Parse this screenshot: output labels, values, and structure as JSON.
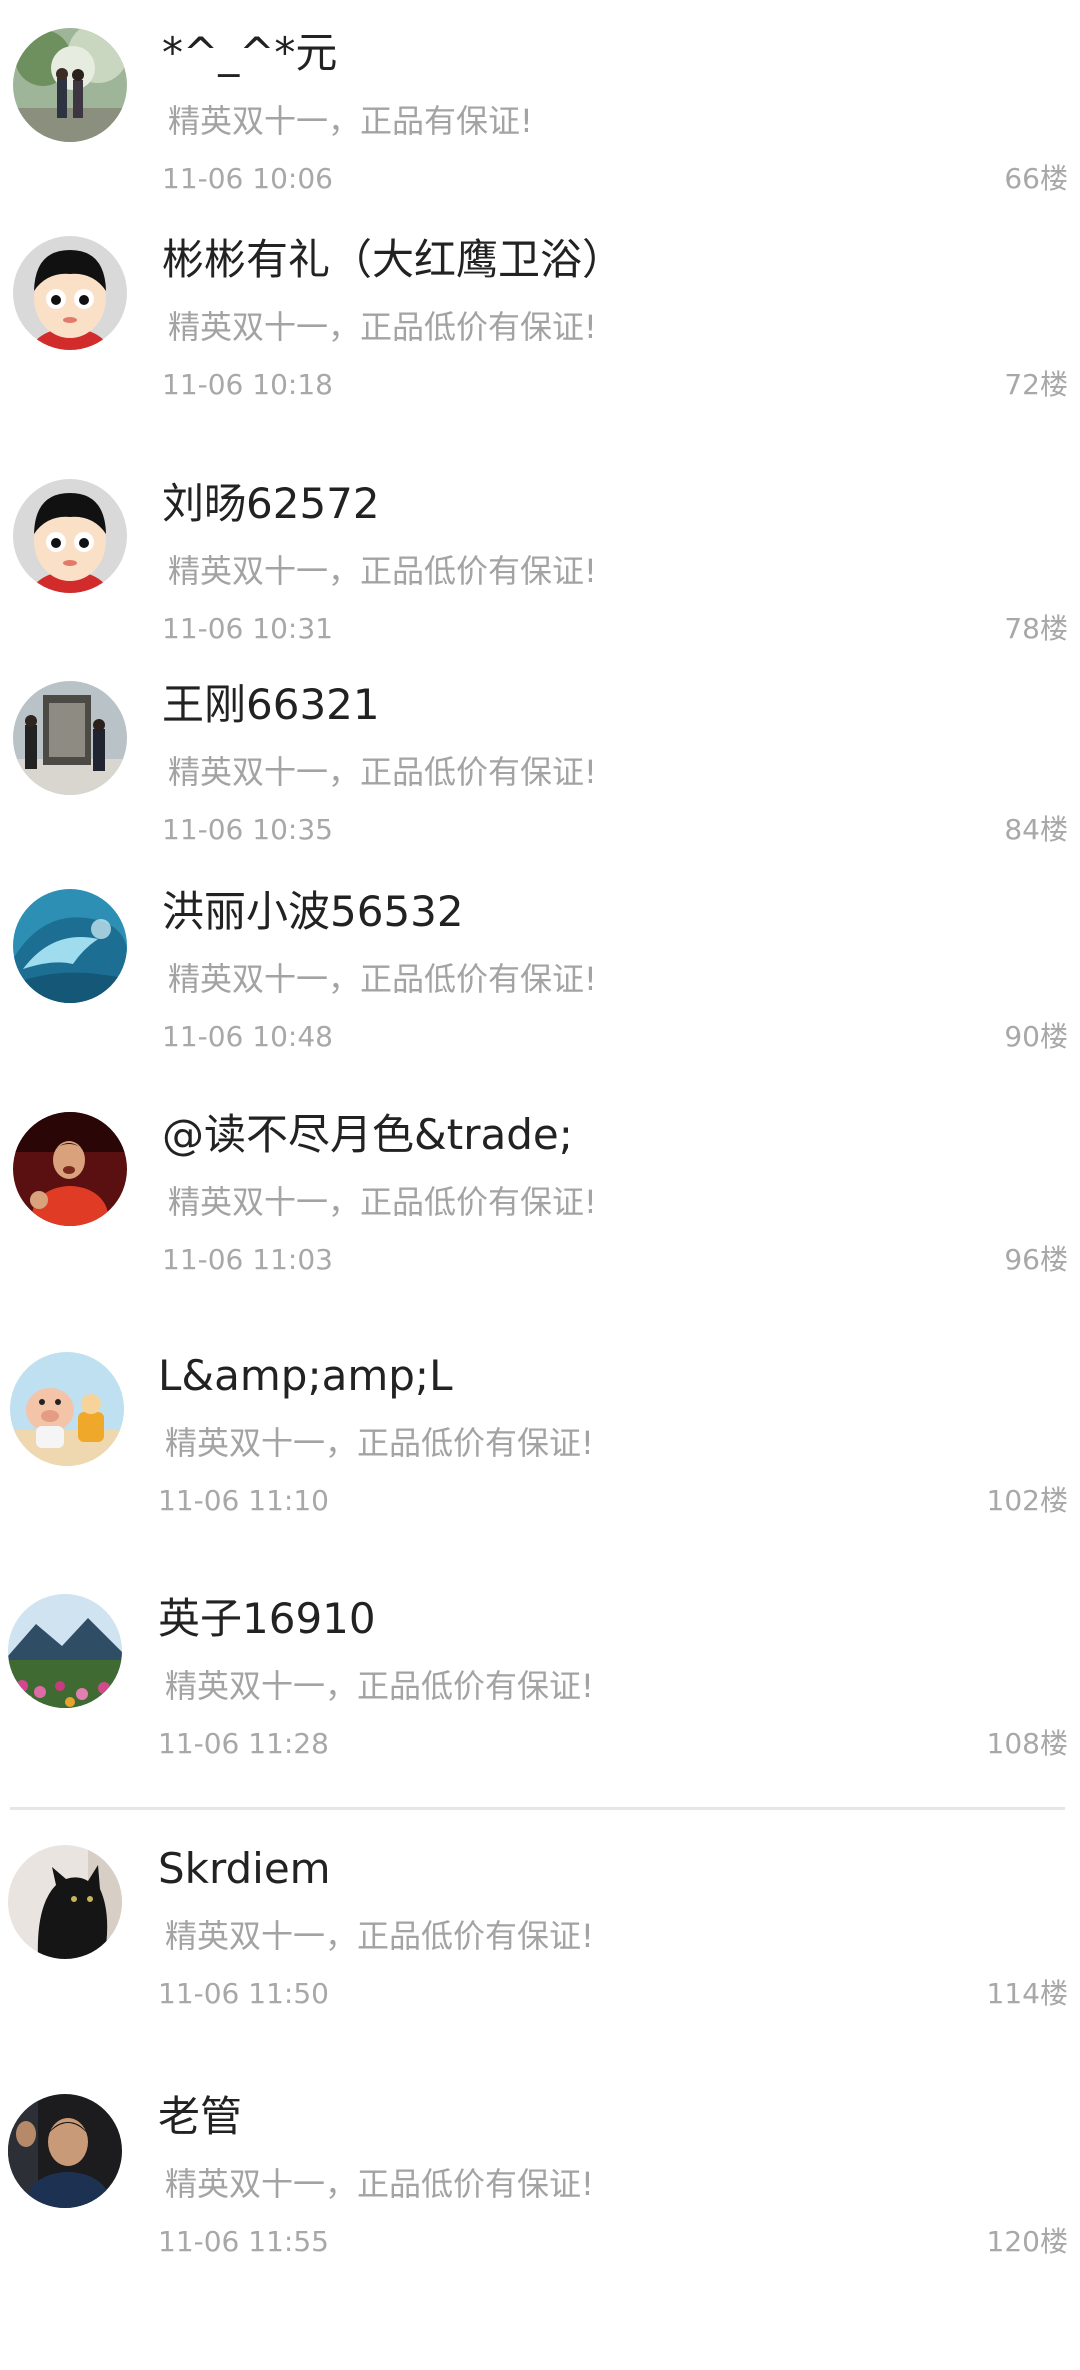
{
  "comments": [
    {
      "username": "*^_^*元",
      "content": "精英双十一，正品有保证!",
      "time": "11-06 10:06",
      "floor": "66楼",
      "avatar_icon": "couple-photo-avatar"
    },
    {
      "username": "彬彬有礼（大红鹰卫浴）",
      "content": "精英双十一，正品低价有保证!",
      "time": "11-06 10:18",
      "floor": "72楼",
      "avatar_icon": "default-cartoon-avatar"
    },
    {
      "username": "刘旸62572",
      "content": "精英双十一，正品低价有保证!",
      "time": "11-06 10:31",
      "floor": "78楼",
      "avatar_icon": "default-cartoon-avatar"
    },
    {
      "username": "王刚66321",
      "content": "精英双十一，正品低价有保证!",
      "time": "11-06 10:35",
      "floor": "84楼",
      "avatar_icon": "monument-photo-avatar"
    },
    {
      "username": "洪丽小波56532",
      "content": "精英双十一，正品低价有保证!",
      "time": "11-06 10:48",
      "floor": "90楼",
      "avatar_icon": "ocean-wave-avatar"
    },
    {
      "username": "@读不尽月色&trade;",
      "content": "精英双十一，正品低价有保证!",
      "time": "11-06 11:03",
      "floor": "96楼",
      "avatar_icon": "athlete-photo-avatar"
    },
    {
      "username": "L&amp;amp;L",
      "content": "精英双十一，正品低价有保证!",
      "time": "11-06 11:10",
      "floor": "102楼",
      "avatar_icon": "cartoon-pig-avatar"
    },
    {
      "username": "英子16910",
      "content": "精英双十一，正品低价有保证!",
      "time": "11-06 11:28",
      "floor": "108楼",
      "avatar_icon": "mountain-landscape-avatar"
    },
    {
      "username": "Skrdiem",
      "content": "精英双十一，正品低价有保证!",
      "time": "11-06 11:50",
      "floor": "114楼",
      "avatar_icon": "black-cat-avatar"
    },
    {
      "username": "老管",
      "content": "精英双十一，正品低价有保证!",
      "time": "11-06 11:55",
      "floor": "120楼",
      "avatar_icon": "man-photo-avatar"
    }
  ],
  "colors": {
    "username": "#222222",
    "secondary_text": "#a3a3a3",
    "divider": "#e6e6e6",
    "background": "#ffffff"
  }
}
